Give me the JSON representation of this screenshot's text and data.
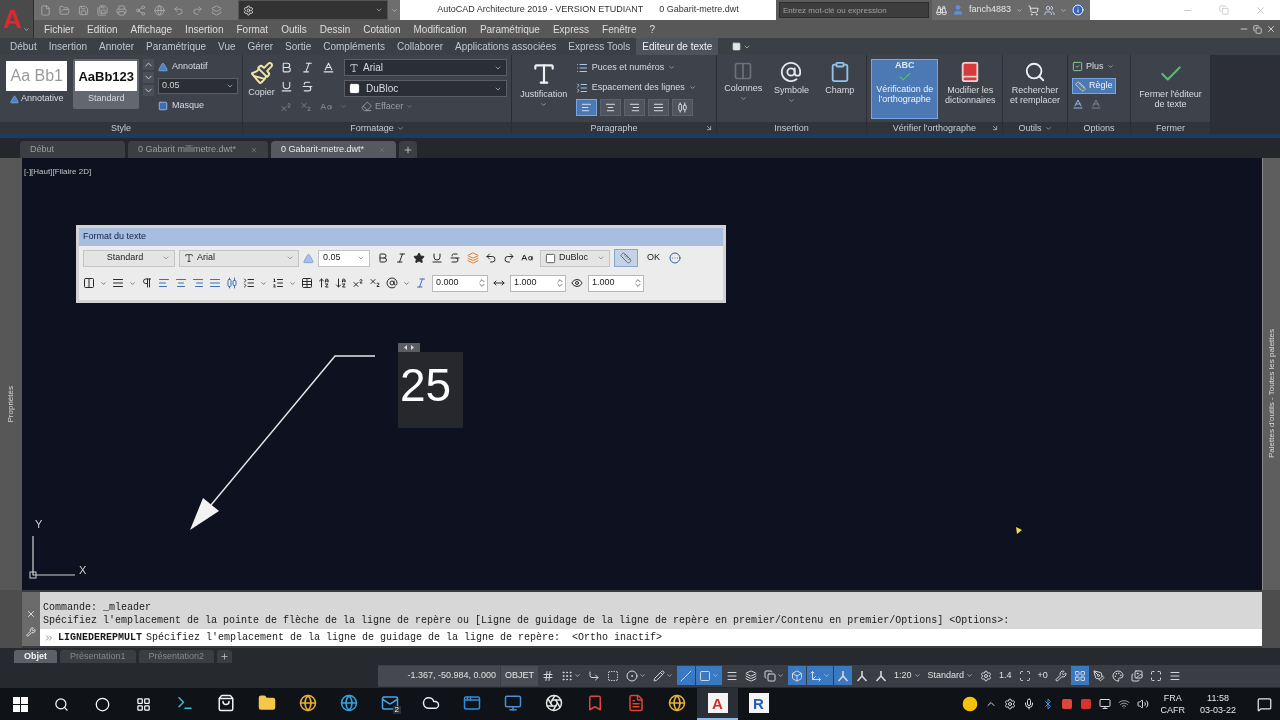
{
  "title_bar": {
    "logo": "A",
    "app_title": "AutoCAD Architecture 2019 - VERSION ETUDIANT",
    "file_name": "0 Gabarit-metre.dwt",
    "search": {
      "placeholder": "Entrez mot-clé ou expression"
    },
    "user_name": "fanch4883"
  },
  "menu_bar": [
    "Fichier",
    "Edition",
    "Affichage",
    "Insertion",
    "Format",
    "Outils",
    "Dessin",
    "Cotation",
    "Modification",
    "Paramétrique",
    "Express",
    "Fenêtre",
    "?"
  ],
  "ribbon": {
    "tabs": [
      {
        "label": "Début",
        "selected": false
      },
      {
        "label": "Insertion",
        "selected": false
      },
      {
        "label": "Annoter",
        "selected": false
      },
      {
        "label": "Paramétrique",
        "selected": false
      },
      {
        "label": "Vue",
        "selected": false
      },
      {
        "label": "Gérer",
        "selected": false
      },
      {
        "label": "Sortie",
        "selected": false
      },
      {
        "label": "Compléments",
        "selected": false
      },
      {
        "label": "Collaborer",
        "selected": false
      },
      {
        "label": "Applications associées",
        "selected": false
      },
      {
        "label": "Express Tools",
        "selected": false
      },
      {
        "label": "Editeur de texte",
        "selected": true
      }
    ],
    "style_panel": {
      "label": "Style",
      "styles": [
        {
          "preview": "Aa Bb1",
          "name": "Annotative",
          "kind": "annotative",
          "selected": false
        },
        {
          "preview": "AaBb123",
          "name": "Standard",
          "kind": "plain",
          "selected": true
        }
      ],
      "annotative_toggle": "Annotatif",
      "text_height": {
        "value": "0.05"
      },
      "mask_button": "Masque"
    },
    "formatting_panel": {
      "label": "Formatage",
      "match_button": "Copier",
      "font": {
        "value": "Arial"
      },
      "color": {
        "value": "DuBloc"
      },
      "clear_button": {
        "label": "Effacer",
        "disabled": true
      }
    },
    "paragraph_panel": {
      "label": "Paragraphe",
      "justification_button": "Justification",
      "bullets_button": "Puces et numéros",
      "line_spacing_button": "Espacement des lignes",
      "alignments": [
        {
          "selected": true
        },
        {
          "selected": false
        },
        {
          "selected": false
        },
        {
          "selected": false
        },
        {
          "selected": false
        }
      ]
    },
    "insert_panel": {
      "label": "Insertion",
      "buttons": [
        {
          "label": "Colonnes",
          "kind": "columns",
          "disabled": true,
          "menu": true
        },
        {
          "label": "Symbole",
          "kind": "symbol",
          "disabled": false,
          "menu": true
        },
        {
          "label": "Champ",
          "kind": "field",
          "disabled": false,
          "menu": false
        }
      ]
    },
    "spelling_panel": {
      "label": "Vérifier l'orthographe",
      "check_button": {
        "label": "Vérification de l'orthographe",
        "icon_text": "ABC",
        "on": true
      },
      "dictionaries_button": "Modifier les dictionnaires"
    },
    "tools_panel": {
      "label": "Outils",
      "find_button": "Rechercher et remplacer"
    },
    "options_panel": {
      "label": "Options",
      "more_button": "Plus",
      "ruler_button": {
        "label": "Règle",
        "on": true
      }
    },
    "close_panel": {
      "label": "Fermer",
      "close_button": "Fermer l'éditeur de texte"
    }
  },
  "document_tabs": [
    {
      "label": "Début",
      "selected": false
    },
    {
      "label": "0 Gabarit millimetre.dwt*",
      "selected": false
    },
    {
      "label": "0 Gabarit-metre.dwt*",
      "selected": true
    }
  ],
  "drawing_area": {
    "viewport_label": "[-][Haut][Filaire 2D]",
    "left_palette": "Propriétés",
    "right_palette": "Palettes d'outils - Toutes les palettes",
    "text_format_toolbar": {
      "title": "Format du texte",
      "style": {
        "value": "Standard"
      },
      "font": {
        "value": "Arial"
      },
      "text_height": {
        "value": "0.05"
      },
      "color": {
        "value": "DuBloc"
      },
      "ruler_button": {
        "on": true
      },
      "ok_button": "OK",
      "oblique_angle": {
        "value": "0.000"
      },
      "tracking": {
        "value": "1.000"
      },
      "width_factor": {
        "value": "1.000"
      }
    },
    "mtext": "25",
    "ucs": {
      "y_label": "Y",
      "x_label": "X"
    }
  },
  "command_line": {
    "history": [
      "Commande: _mleader",
      "Spécifiez l'emplacement de la pointe de flèche de la ligne de repère ou [Ligne de guidage de la ligne de repère en premier/Contenu en premier/Options] <Options>:"
    ],
    "command": "LIGNEDEREPMULT",
    "prompt": "Spécifiez l'emplacement de la ligne de guidage de la ligne de repère:  <Ortho inactif>"
  },
  "layout_tabs": [
    {
      "label": "Objet",
      "selected": true
    },
    {
      "label": "Présentation1",
      "selected": false
    },
    {
      "label": "Présentation2",
      "selected": false
    }
  ],
  "status_bar": {
    "coordinates": "-1.367, -50.984, 0.000",
    "model_button": "OBJET",
    "items": [
      {
        "kind": "toggle",
        "on": false,
        "menu": false
      },
      {
        "kind": "toggle",
        "on": false,
        "menu": true
      },
      {
        "kind": "toggle",
        "on": false,
        "menu": false
      },
      {
        "kind": "toggle",
        "on": false,
        "menu": false
      },
      {
        "kind": "toggle",
        "on": false,
        "menu": true
      },
      {
        "kind": "toggle",
        "on": false,
        "menu": true
      },
      {
        "kind": "toggle",
        "on": true,
        "menu": false
      },
      {
        "kind": "toggle",
        "on": true,
        "menu": true
      },
      {
        "kind": "toggle",
        "on": false,
        "menu": false
      },
      {
        "kind": "toggle",
        "on": false,
        "menu": false
      },
      {
        "kind": "toggle",
        "on": false,
        "menu": true
      },
      {
        "kind": "toggle",
        "on": true,
        "menu": false
      },
      {
        "kind": "toggle",
        "on": true,
        "menu": true
      },
      {
        "kind": "toggle",
        "on": true,
        "menu": false
      },
      {
        "kind": "toggle",
        "on": false,
        "menu": false
      },
      {
        "kind": "toggle",
        "on": false,
        "menu": false
      },
      {
        "kind": "dropdown",
        "text": "1:20"
      },
      {
        "kind": "dropdown",
        "text": "Standard"
      },
      {
        "kind": "toggle",
        "on": false,
        "menu": false
      },
      {
        "kind": "readout",
        "text": "1.4"
      },
      {
        "kind": "toggle",
        "on": false,
        "menu": false
      },
      {
        "kind": "readout",
        "text": "+0"
      },
      {
        "kind": "toggle",
        "on": false,
        "menu": false
      },
      {
        "kind": "toggle",
        "on": true,
        "menu": false
      },
      {
        "kind": "toggle",
        "on": false,
        "menu": false
      },
      {
        "kind": "toggle",
        "on": false,
        "menu": false
      },
      {
        "kind": "toggle",
        "on": false,
        "menu": false
      },
      {
        "kind": "toggle",
        "on": false,
        "menu": false
      },
      {
        "kind": "toggle",
        "on": false,
        "menu": false
      }
    ]
  },
  "taskbar": {
    "apps": [
      {
        "kind": "code",
        "active": false
      },
      {
        "kind": "store",
        "active": false
      },
      {
        "kind": "folder",
        "active": false
      },
      {
        "kind": "browser",
        "active": false
      },
      {
        "kind": "web",
        "active": false
      },
      {
        "kind": "mail",
        "active": false,
        "badge": "2"
      },
      {
        "kind": "cloud",
        "active": false
      },
      {
        "kind": "tile",
        "active": false
      },
      {
        "kind": "window",
        "active": false
      },
      {
        "kind": "aperture",
        "active": false
      },
      {
        "kind": "bookmark",
        "active": false
      },
      {
        "kind": "document",
        "active": false
      },
      {
        "kind": "browser",
        "active": false
      },
      {
        "kind": "letter",
        "glyph": "A",
        "color": "#d42a2a",
        "active": true
      },
      {
        "kind": "letter",
        "glyph": "R",
        "color": "#1f5fb4",
        "active": false
      }
    ],
    "language": "FRA",
    "keyboard": "CAFR",
    "time": "11:58",
    "date": "03-03-22"
  }
}
